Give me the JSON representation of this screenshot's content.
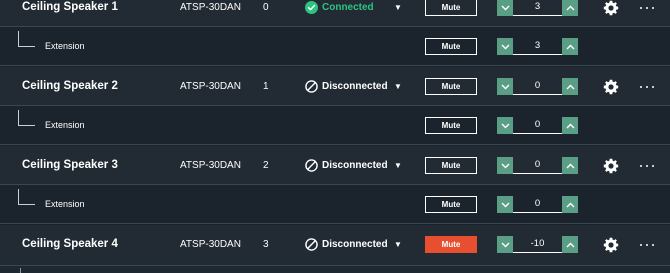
{
  "colors": {
    "connected": "#2bc580",
    "mute_active": "#e84e30",
    "stepper_button": "#5a9e86",
    "row_main": "#222b33",
    "row_ext": "#1b242c"
  },
  "rows": [
    {
      "name": "Ceiling Speaker 1",
      "model": "ATSP-30DAN",
      "index": "0",
      "status": "Connected",
      "status_icon": "check-circle-icon",
      "mute_label": "Mute",
      "muted": false,
      "volume": "3",
      "extension": {
        "label": "Extension",
        "mute_label": "Mute",
        "volume": "3"
      }
    },
    {
      "name": "Ceiling Speaker 2",
      "model": "ATSP-30DAN",
      "index": "1",
      "status": "Disconnected",
      "status_icon": "blocked-circle-icon",
      "mute_label": "Mute",
      "muted": false,
      "volume": "0",
      "extension": {
        "label": "Extension",
        "mute_label": "Mute",
        "volume": "0"
      }
    },
    {
      "name": "Ceiling Speaker 3",
      "model": "ATSP-30DAN",
      "index": "2",
      "status": "Disconnected",
      "status_icon": "blocked-circle-icon",
      "mute_label": "Mute",
      "muted": false,
      "volume": "0",
      "extension": {
        "label": "Extension",
        "mute_label": "Mute",
        "volume": "0"
      }
    },
    {
      "name": "Ceiling Speaker 4",
      "model": "ATSP-30DAN",
      "index": "3",
      "status": "Disconnected",
      "status_icon": "blocked-circle-icon",
      "mute_label": "Mute",
      "muted": true,
      "volume": "-10"
    }
  ]
}
